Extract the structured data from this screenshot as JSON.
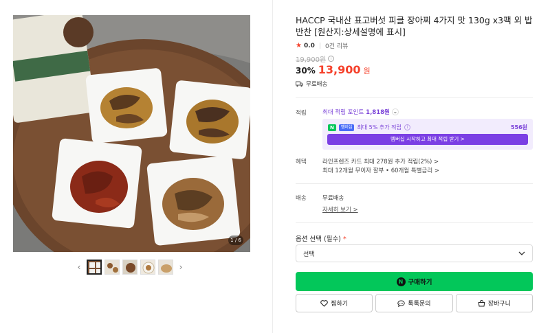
{
  "gallery": {
    "counter": "1 / 6",
    "prev_icon": "chevron-left-icon",
    "next_icon": "chevron-right-icon",
    "thumbnail_count": 5
  },
  "product": {
    "title": "HACCP 국내산 표고버섯 피클 장아찌 4가지 맛 130g x3팩 외 밥반찬 [원산지:상세설명에 표시]",
    "rating_score": "0.0",
    "review_count": "0건 리뷰",
    "original_price": "19,900원",
    "discount_rate": "30%",
    "sale_price": "13,900",
    "currency": "원",
    "shipping": "무료배송"
  },
  "points": {
    "label": "적립",
    "max_point_prefix": "최대 적립 포인트",
    "max_point_value": "1,818원",
    "member_badge": "N",
    "member_plus_badge": "멤버십",
    "member_extra": "최대 5% 추가 적립",
    "member_extra_amount": "556원",
    "member_cta": "멤버십 시작하고 최대 적립 받기 >"
  },
  "benefits": {
    "label": "혜택",
    "line1": "라인프렌즈 카드 최대 278원 추가 적립(2%) >",
    "line2": "최대 12개월 무이자 할부 • 60개월 특별금리 >"
  },
  "delivery": {
    "label": "배송",
    "value": "무료배송",
    "detail_link": "자세히 보기 >"
  },
  "options": {
    "label": "옵션 선택 (필수)",
    "required_mark": "*",
    "select_value": "선택"
  },
  "actions": {
    "buy": "구매하기",
    "buy_badge": "N",
    "wish": "찜하기",
    "talk": "톡톡문의",
    "cart": "장바구니"
  },
  "colors": {
    "accent_red": "#f5402a",
    "naver_green": "#03c75a",
    "membership_purple": "#7b3fe4"
  }
}
